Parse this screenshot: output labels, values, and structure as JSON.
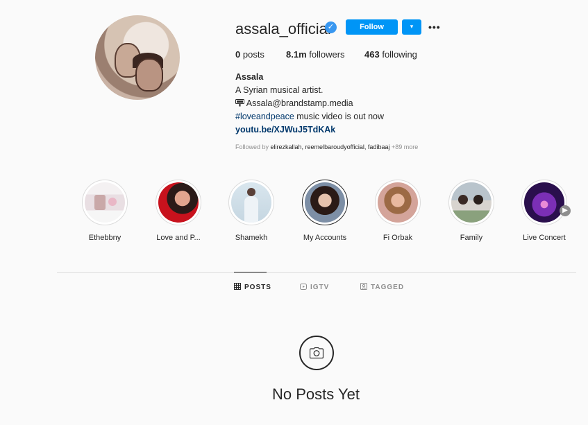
{
  "profile": {
    "username": "assala_official",
    "follow_label": "Follow",
    "dropdown_icon": "▾",
    "more_icon": "•••",
    "verified_icon": "✓"
  },
  "stats": {
    "posts_count": "0",
    "posts_label": "posts",
    "followers_count": "8.1m",
    "followers_label": "followers",
    "following_count": "463",
    "following_label": "following"
  },
  "bio": {
    "name": "Assala",
    "line1": "A Syrian musical artist.",
    "email": "Assala@brandstamp.media",
    "hashtag": "#loveandpeace",
    "line3_rest": " music video is out now",
    "link": "youtu.be/XJWuJ5TdKAk"
  },
  "followed_by": {
    "prefix": "Followed by ",
    "names": "elirezkallah, reemelbaroudyofficial, fadibaaj",
    "more": " +89 more"
  },
  "highlights": [
    {
      "label": "Ethebbny"
    },
    {
      "label": "Love and P..."
    },
    {
      "label": "Shamekh"
    },
    {
      "label": "My Accounts"
    },
    {
      "label": "Fi Orbak"
    },
    {
      "label": "Family"
    },
    {
      "label": "Live Concert"
    }
  ],
  "tabs": {
    "posts": "POSTS",
    "igtv": "IGTV",
    "tagged": "TAGGED"
  },
  "empty_state": {
    "message": "No Posts Yet"
  },
  "colors": {
    "accent": "#0095f6",
    "link": "#00376b",
    "muted": "#8e8e8e",
    "background": "#fafafa"
  }
}
